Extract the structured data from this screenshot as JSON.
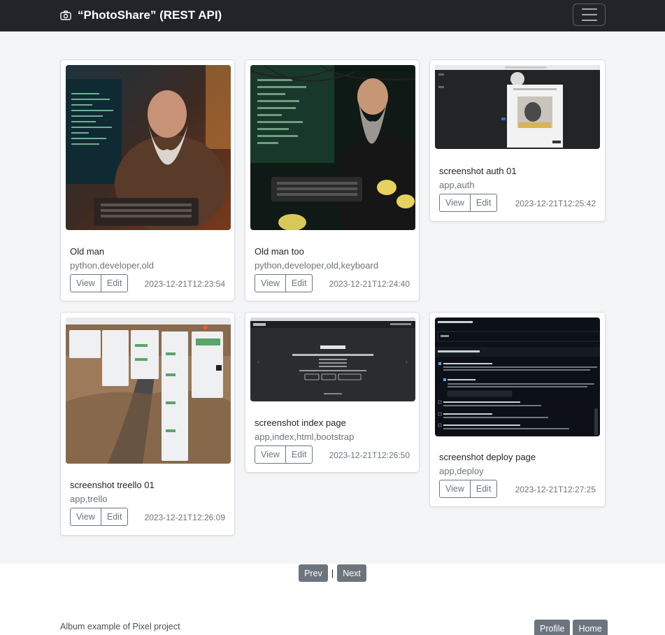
{
  "navbar": {
    "brand_title": "“PhotoShare” (REST API)",
    "brand_icon": "camera-icon",
    "menu_icon": "hamburger-menu-icon"
  },
  "cards": [
    {
      "title": "Old man",
      "tags": "python,developer,old",
      "date": "2023-12-21T12:23:54",
      "view_label": "View",
      "edit_label": "Edit"
    },
    {
      "title": "Old man too",
      "tags": "python,developer,old,keyboard",
      "date": "2023-12-21T12:24:40",
      "view_label": "View",
      "edit_label": "Edit"
    },
    {
      "title": "screenshot auth 01",
      "tags": "app,auth",
      "date": "2023-12-21T12:25:42",
      "view_label": "View",
      "edit_label": "Edit"
    },
    {
      "title": "screenshot treello 01",
      "tags": "app,trello",
      "date": "2023-12-21T12:26:09",
      "view_label": "View",
      "edit_label": "Edit"
    },
    {
      "title": "screenshot index page",
      "tags": "app,index,html,bootstrap",
      "date": "2023-12-21T12:26:50",
      "view_label": "View",
      "edit_label": "Edit"
    },
    {
      "title": "screenshot deploy page",
      "tags": "app,deploy",
      "date": "2023-12-21T12:27:25",
      "view_label": "View",
      "edit_label": "Edit"
    }
  ],
  "pagination": {
    "prev_label": "Prev",
    "separator": "|",
    "next_label": "Next"
  },
  "footer": {
    "text": "Album example of Pixel project",
    "profile_label": "Profile",
    "home_label": "Home"
  },
  "colors": {
    "navbar_bg": "#212529",
    "album_bg": "#f4f5f7",
    "secondary": "#6c757d"
  }
}
